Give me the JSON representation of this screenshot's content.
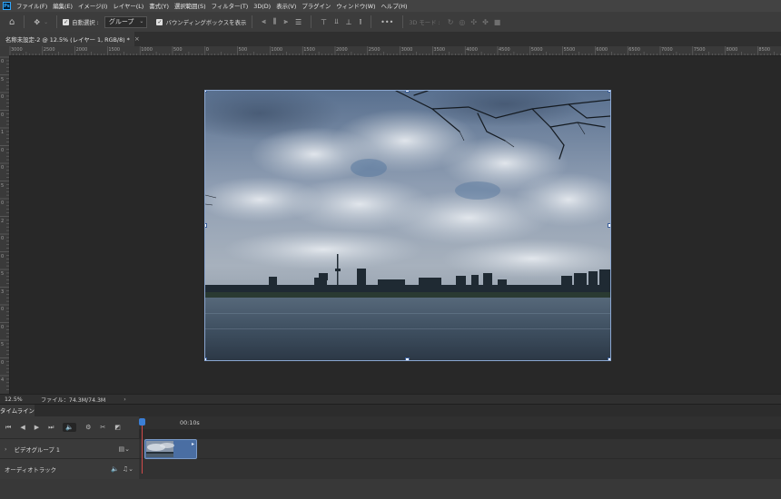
{
  "menubar": {
    "logo": "Ps",
    "items": [
      "ファイル(F)",
      "編集(E)",
      "イメージ(I)",
      "レイヤー(L)",
      "書式(Y)",
      "選択範囲(S)",
      "フィルター(T)",
      "3D(D)",
      "表示(V)",
      "プラグイン",
      "ウィンドウ(W)",
      "ヘルプ(H)"
    ]
  },
  "options": {
    "auto_select_label": "自動選択 :",
    "auto_select_value": "グループ",
    "show_bbox_label": "バウンディングボックスを表示",
    "more": "•••",
    "mode_3d": "3D モード :"
  },
  "document": {
    "tab_title": "名称未設定-2 @ 12.5% (レイヤー 1, RGB/8) *",
    "close": "×"
  },
  "rulers": {
    "top": [
      "3000",
      "2500",
      "2000",
      "1500",
      "1000",
      "500",
      "0",
      "500",
      "1000",
      "1500",
      "2000",
      "2500",
      "3000",
      "3500",
      "4000",
      "4500",
      "5000",
      "5500",
      "6000",
      "6500",
      "7000",
      "7500",
      "8000",
      "8500"
    ],
    "left": [
      "0",
      "5",
      "0",
      "0",
      "1",
      "0",
      "0",
      "5",
      "0",
      "2",
      "0",
      "0",
      "5",
      "3",
      "0",
      "0",
      "5",
      "0",
      "4"
    ]
  },
  "status": {
    "zoom": "12.5%",
    "file": "ファイル：74.3M/74.3M",
    "arrow": "›"
  },
  "timeline": {
    "tab_label": "タイムライン",
    "time_label": "00:10s",
    "tracks": [
      {
        "name": "ビデオグループ 1",
        "expand": "›"
      },
      {
        "name": "オーディオトラック"
      }
    ]
  },
  "colors": {
    "accent": "#3b7fd6",
    "playhead": "#d04a4a",
    "clip": "#4a6ea3"
  }
}
